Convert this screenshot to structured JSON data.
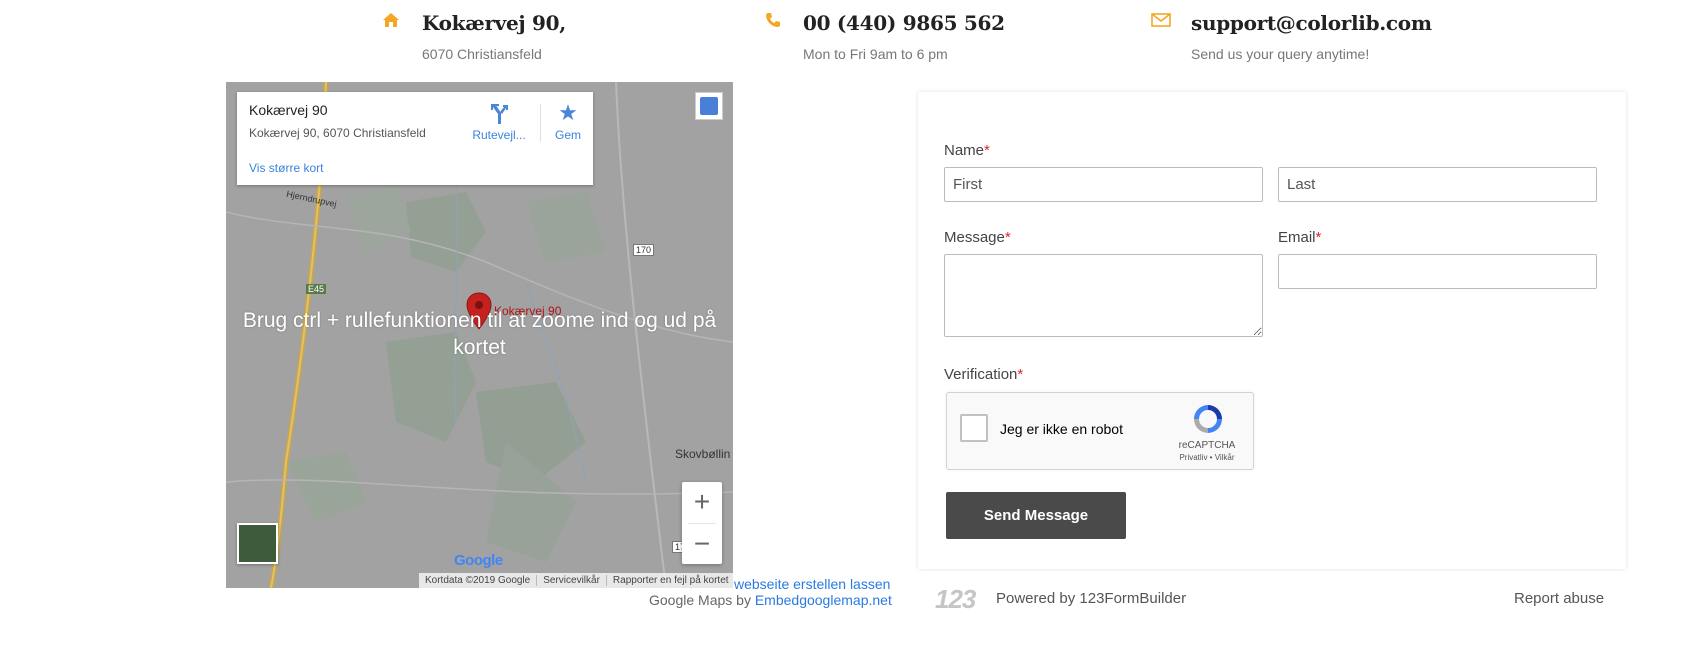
{
  "contact": [
    {
      "icon": "home-icon",
      "title": "Kokærvej 90,",
      "subtitle": "6070 Christiansfeld"
    },
    {
      "icon": "phone-icon",
      "title": "00 (440) 9865 562",
      "subtitle": "Mon to Fri 9am to 6 pm"
    },
    {
      "icon": "envelope-icon",
      "title": "support@colorlib.com",
      "subtitle": "Send us your query anytime!"
    }
  ],
  "map": {
    "place_title": "Kokærvej 90",
    "place_address": "Kokærvej 90, 6070 Christiansfeld",
    "directions_label": "Rutevejl...",
    "save_label": "Gem",
    "larger_map_link": "Vis større kort",
    "overlay_text": "Brug ctrl + rullefunktionen til at zoome ind og ud på kortet",
    "marker_label": "Kokærvej 90",
    "labels": {
      "hjerndrupvej": "Hjerndrupvej",
      "e45": "E45",
      "r170": "170",
      "skovbolling": "Skovbøllin",
      "r17": "17"
    },
    "zoom_in": "+",
    "zoom_out": "−",
    "google_logo": "Google",
    "attribution": {
      "data": "Kortdata ©2019 Google",
      "terms": "Servicevilkår",
      "report": "Rapporter en fejl på kortet"
    }
  },
  "below_map": {
    "link1": "webseite erstellen lassen",
    "line2_prefix": "Google Maps by",
    "line2_link": "Embedgooglemap.net"
  },
  "form": {
    "name_label": "Name",
    "required_mark": "*",
    "first_placeholder": "First",
    "last_placeholder": "Last",
    "message_label": "Message",
    "email_label": "Email",
    "verification_label": "Verification",
    "captcha_text": "Jeg er ikke en robot",
    "captcha_brand": "reCAPTCHA",
    "captcha_terms": "Privatliv • Vilkår",
    "send_label": "Send Message"
  },
  "footer": {
    "logo": "123",
    "powered_by": "Powered by 123FormBuilder",
    "report_abuse": "Report abuse"
  },
  "colors": {
    "accent": "#f5a623",
    "required": "#e0262c",
    "link": "#2a7ae2",
    "button": "#4a4a4a"
  }
}
